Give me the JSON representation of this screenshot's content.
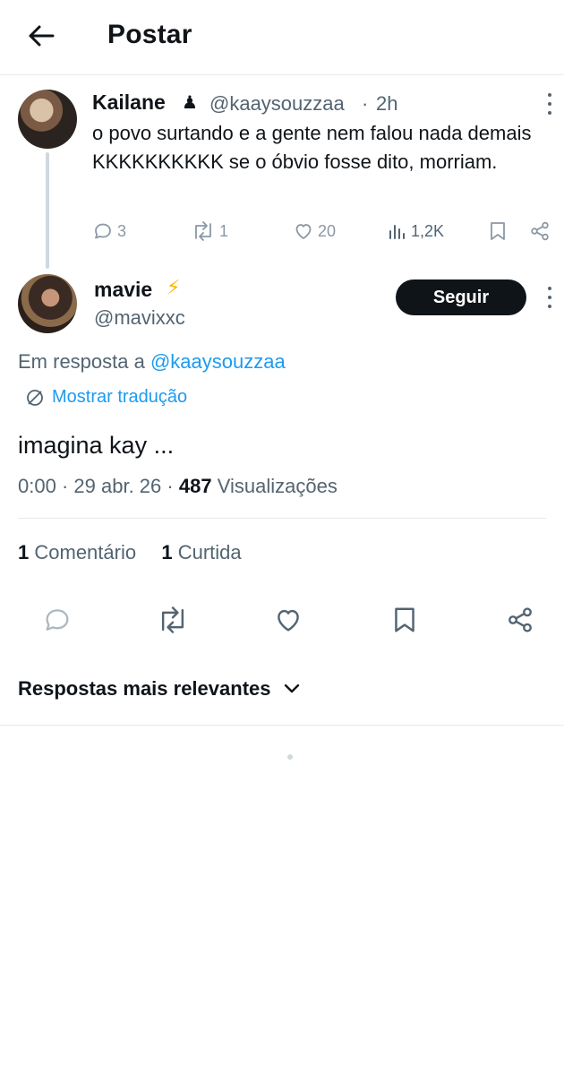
{
  "header": {
    "title": "Postar"
  },
  "parent_post": {
    "name": "Kailane",
    "emoji": "♟",
    "handle": "@kaaysouzzaa",
    "separator": "·",
    "time": "2h",
    "text": "o povo surtando e a gente nem falou nada demais KKKKKKKKKK se o óbvio fosse dito, morriam.",
    "replies": "3",
    "reposts": "1",
    "likes": "20",
    "views": "1,2K"
  },
  "post": {
    "name": "mavie",
    "badge": "⚡",
    "handle": "@mavixxc",
    "follow_label": "Seguir",
    "reply_prefix": "Em resposta a",
    "reply_mention": "@kaaysouzzaa",
    "translate_label": "Mostrar tradução",
    "text": "imagina kay ...",
    "time": "0:00",
    "date": "29 abr. 26",
    "views_count": "487",
    "views_label": "Visualizações",
    "comments_count": "1",
    "comments_label": "Comentário",
    "likes_count": "1",
    "likes_label": "Curtida"
  },
  "replies_sort": {
    "label": "Respostas mais relevantes"
  },
  "colors": {
    "accent": "#1d9bf0",
    "text": "#0f1419",
    "muted": "#536471",
    "border": "#e7e9ea"
  }
}
